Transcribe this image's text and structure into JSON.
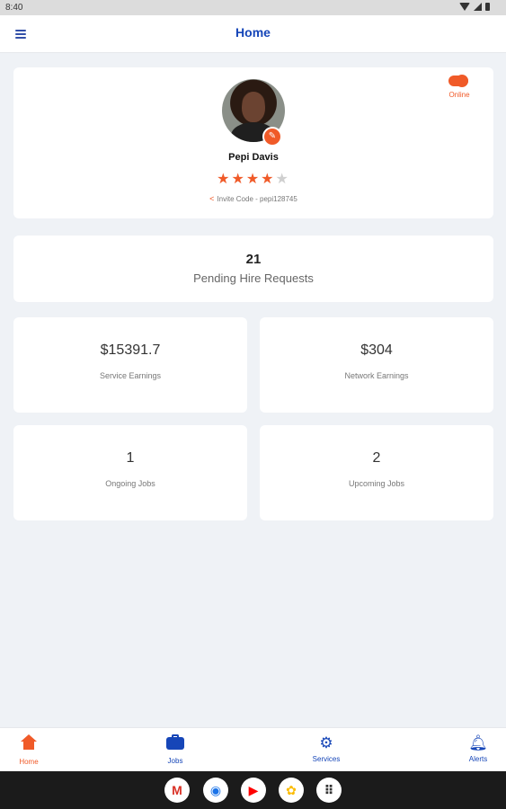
{
  "status_bar": {
    "time": "8:40"
  },
  "app_bar": {
    "title": "Home",
    "menu_icon": "hamburger-icon"
  },
  "profile": {
    "name": "Pepi Davis",
    "rating": 4,
    "rating_max": 5,
    "invite_text": "Invite Code - pepi128745",
    "online_label": "Online",
    "online": true
  },
  "pending": {
    "count": "21",
    "label": "Pending Hire Requests"
  },
  "stats": [
    {
      "value": "$15391.7",
      "label": "Service Earnings"
    },
    {
      "value": "$304",
      "label": "Network Earnings"
    },
    {
      "value": "1",
      "label": "Ongoing Jobs"
    },
    {
      "value": "2",
      "label": "Upcoming Jobs"
    }
  ],
  "bottom_nav": [
    {
      "label": "Home",
      "icon": "home-icon",
      "active": true
    },
    {
      "label": "Jobs",
      "icon": "briefcase-icon",
      "active": false
    },
    {
      "label": "Services",
      "icon": "gear-icon",
      "active": false
    },
    {
      "label": "Alerts",
      "icon": "bell-icon",
      "active": false
    }
  ],
  "dock": [
    {
      "icon": "gmail-icon",
      "glyph": "M",
      "color": "#d93025"
    },
    {
      "icon": "chrome-icon",
      "glyph": "◉",
      "color": "#1a73e8"
    },
    {
      "icon": "youtube-icon",
      "glyph": "▶",
      "color": "#ff0000"
    },
    {
      "icon": "photos-icon",
      "glyph": "✿",
      "color": "#fbbc04"
    },
    {
      "icon": "apps-grid-icon",
      "glyph": "⠿",
      "color": "#333333"
    }
  ],
  "colors": {
    "accent": "#f05a28",
    "brand": "#1646b8",
    "background": "#eff2f6"
  }
}
